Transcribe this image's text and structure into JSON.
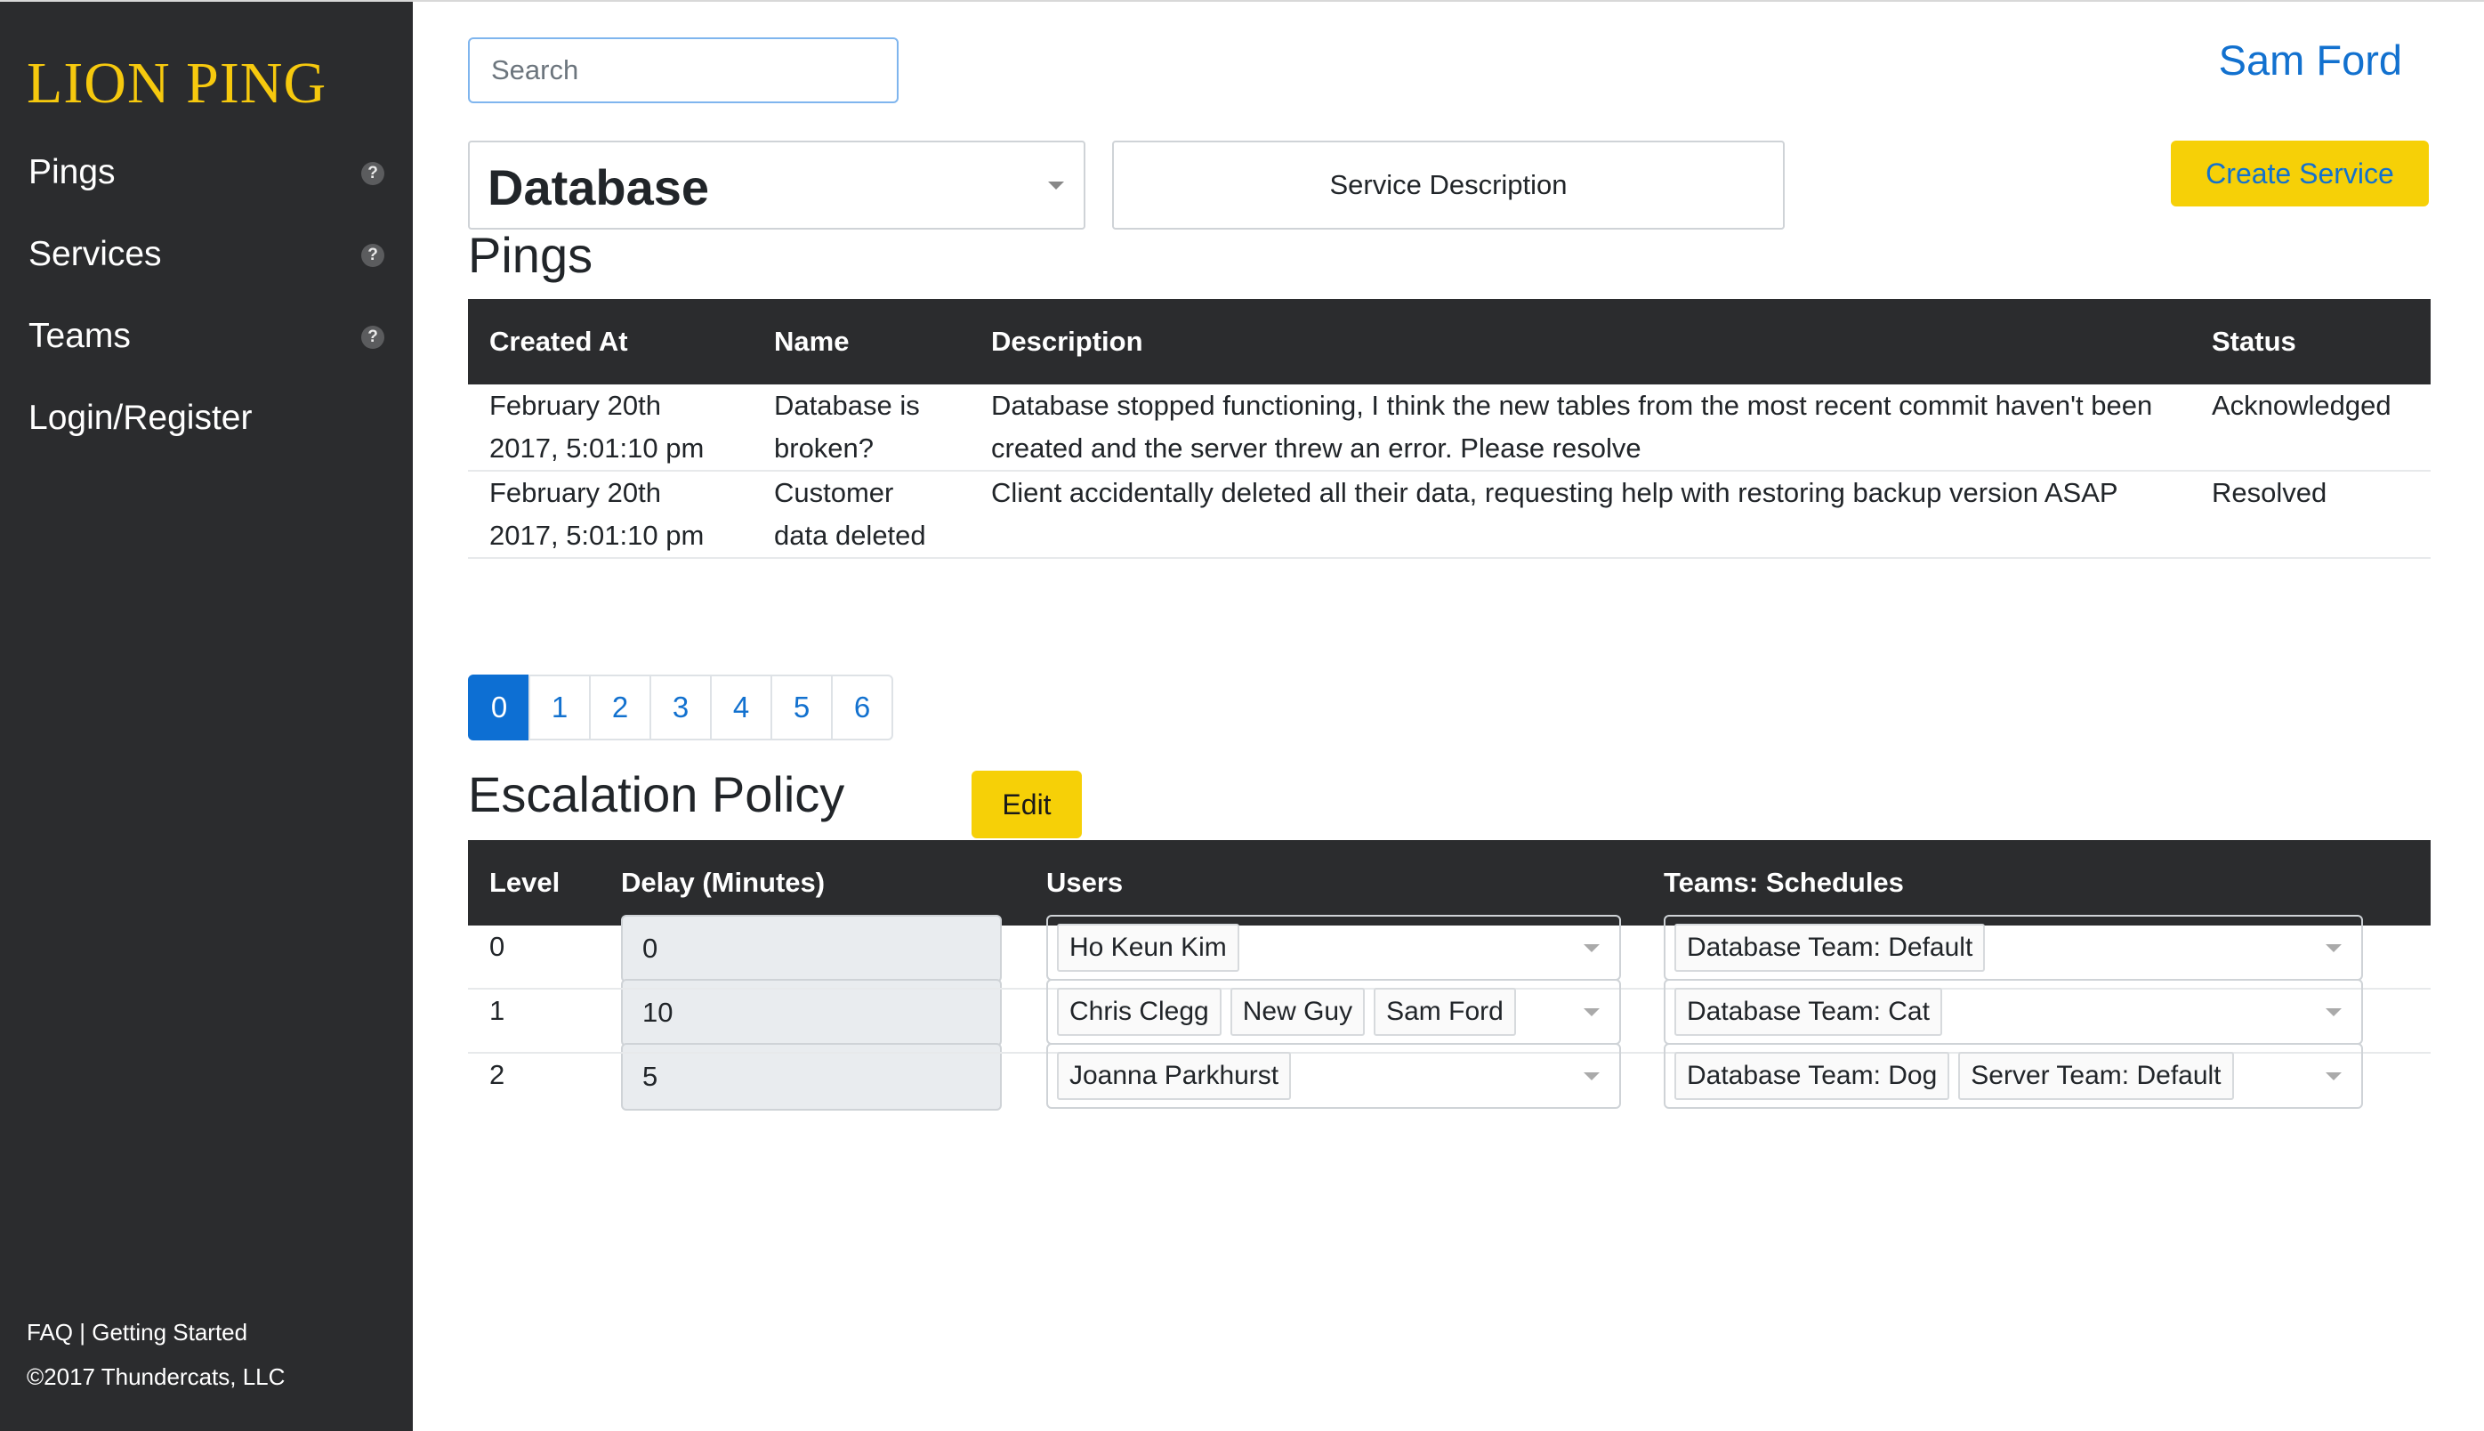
{
  "sidebar": {
    "brand": "LION PING",
    "items": [
      {
        "label": "Pings",
        "help": "?"
      },
      {
        "label": "Services",
        "help": "?"
      },
      {
        "label": "Teams",
        "help": "?"
      },
      {
        "label": "Login/Register"
      }
    ],
    "footer_links": "FAQ | Getting Started",
    "copyright": "©2017 Thundercats, LLC"
  },
  "header": {
    "search_placeholder": "Search",
    "user_name": "Sam Ford"
  },
  "service_bar": {
    "selected_service": "Database",
    "description_button": "Service Description",
    "create_button": "Create Service"
  },
  "pings": {
    "title": "Pings",
    "columns": [
      "Created At",
      "Name",
      "Description",
      "Status"
    ],
    "rows": [
      {
        "created_line1": "February 20th",
        "created_line2": "2017, 5:01:10 pm",
        "name_line1": "Database is",
        "name_line2": "broken?",
        "description": "Database stopped functioning, I think the new tables from the most recent commit haven't been created and the server threw an error. Please resolve",
        "status": "Acknowledged"
      },
      {
        "created_line1": "February 20th",
        "created_line2": "2017, 5:01:10 pm",
        "name_line1": "Customer",
        "name_line2": "data deleted",
        "description": "Client accidentally deleted all their data, requesting help with restoring backup version ASAP",
        "status": "Resolved"
      }
    ],
    "pages": [
      "0",
      "1",
      "2",
      "3",
      "4",
      "5",
      "6"
    ],
    "active_page": "0"
  },
  "escalation": {
    "title": "Escalation Policy",
    "edit_button": "Edit",
    "columns": [
      "Level",
      "Delay (Minutes)",
      "Users",
      "Teams: Schedules"
    ],
    "rows": [
      {
        "level": "0",
        "delay": "0",
        "users": [
          "Ho Keun Kim"
        ],
        "teams": [
          "Database Team: Default"
        ]
      },
      {
        "level": "1",
        "delay": "10",
        "users": [
          "Chris Clegg",
          "New Guy",
          "Sam Ford"
        ],
        "teams": [
          "Database Team: Cat"
        ]
      },
      {
        "level": "2",
        "delay": "5",
        "users": [
          "Joanna Parkhurst"
        ],
        "teams": [
          "Database Team: Dog",
          "Server Team: Default"
        ]
      }
    ]
  },
  "colors": {
    "sidebar_bg": "#2b2c2e",
    "brand": "#f6c90e",
    "accent_blue": "#1271cf",
    "button_yellow": "#f6d007",
    "table_header_bg": "#2b2c2e"
  }
}
